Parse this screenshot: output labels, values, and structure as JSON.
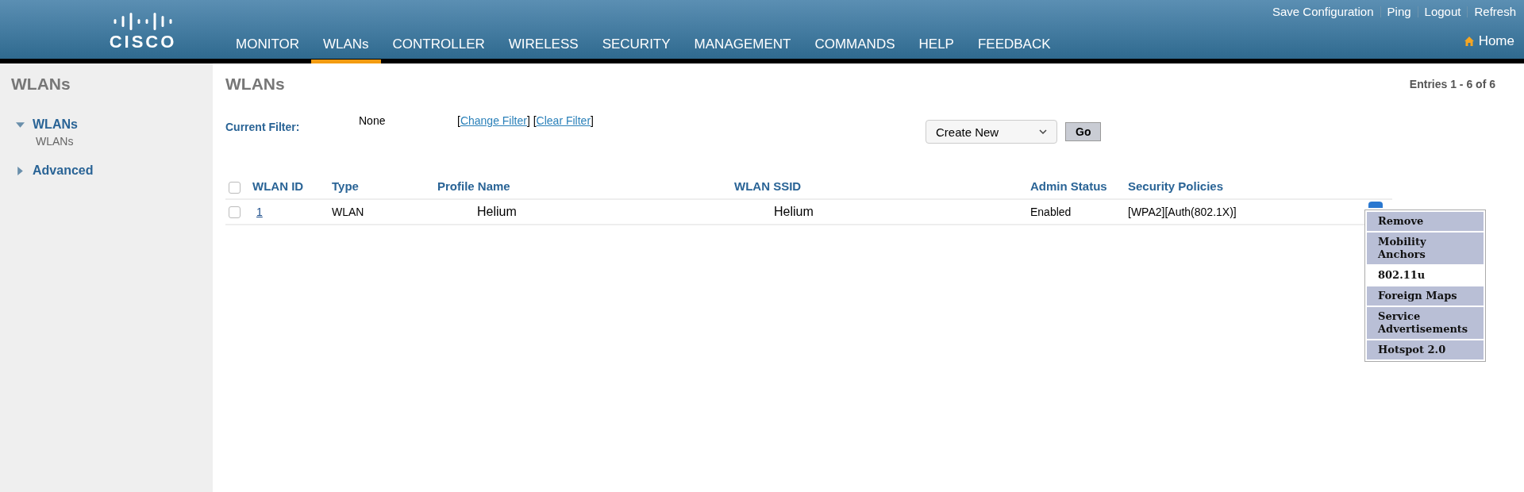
{
  "header": {
    "logo": "CISCO",
    "top_links": [
      "Save Configuration",
      "Ping",
      "Logout",
      "Refresh"
    ],
    "nav": [
      {
        "label": "MONITOR",
        "selected": false
      },
      {
        "label": "WLANs",
        "selected": true
      },
      {
        "label": "CONTROLLER",
        "selected": false
      },
      {
        "label": "WIRELESS",
        "selected": false
      },
      {
        "label": "SECURITY",
        "selected": false
      },
      {
        "label": "MANAGEMENT",
        "selected": false
      },
      {
        "label": "COMMANDS",
        "selected": false
      },
      {
        "label": "HELP",
        "selected": false
      },
      {
        "label": "FEEDBACK",
        "selected": false
      }
    ],
    "home": "Home"
  },
  "sidebar": {
    "title": "WLANs",
    "items": [
      {
        "label": "WLANs",
        "expanded": true,
        "children": [
          {
            "label": "WLANs"
          }
        ]
      },
      {
        "label": "Advanced",
        "expanded": false
      }
    ]
  },
  "main": {
    "title": "WLANs",
    "entries": "Entries 1 - 6 of 6",
    "filter_label": "Current Filter:",
    "filter_value": "None",
    "filter_links": [
      {
        "kind": "text",
        "text": "["
      },
      {
        "kind": "link",
        "text": "Change Filter"
      },
      {
        "kind": "text",
        "text": "] ["
      },
      {
        "kind": "link",
        "text": "Clear Filter"
      },
      {
        "kind": "text",
        "text": "]"
      }
    ],
    "create_select": "Create New",
    "go": "Go",
    "table": {
      "select_all_checked": false,
      "columns": [
        "WLAN ID",
        "Type",
        "Profile Name",
        "WLAN SSID",
        "Admin Status",
        "Security Policies"
      ],
      "rows": [
        {
          "checked": false,
          "id": "1",
          "type": "WLAN",
          "profile": "Helium",
          "ssid": "Helium",
          "status": "Enabled",
          "security": "[WPA2][Auth(802.1X)]"
        }
      ]
    },
    "menu": [
      {
        "label": "Remove",
        "selected": false
      },
      {
        "label": "Mobility Anchors",
        "selected": false
      },
      {
        "label": "802.11u",
        "selected": true
      },
      {
        "label": "Foreign Maps",
        "selected": false
      },
      {
        "label": "Service Advertisements",
        "selected": false
      },
      {
        "label": "Hotspot 2.0",
        "selected": false
      }
    ]
  }
}
